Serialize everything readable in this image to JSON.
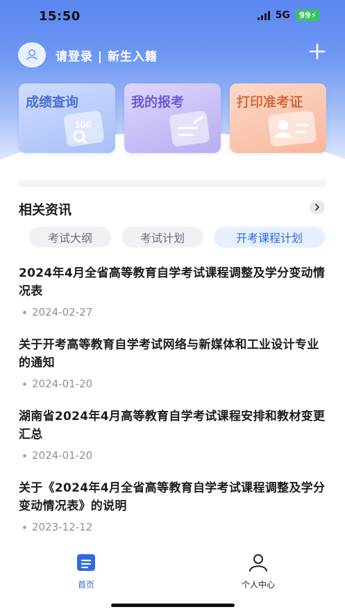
{
  "status_bar": {
    "time": "15:50",
    "network": "5G",
    "battery": "99"
  },
  "header": {
    "login_text": "请登录 | 新生入籍"
  },
  "cards": [
    {
      "label": "成绩查询"
    },
    {
      "label": "我的报考"
    },
    {
      "label": "打印准考证"
    }
  ],
  "card_deco_text": "100",
  "section": {
    "title": "相关资讯"
  },
  "tabs": [
    {
      "label": "考试大纲",
      "selected": false
    },
    {
      "label": "考试计划",
      "selected": false
    },
    {
      "label": "开考课程计划",
      "selected": true
    }
  ],
  "news": [
    {
      "title": "2024年4月全省高等教育自学考试课程调整及学分变动情况表",
      "date": "2024-02-27"
    },
    {
      "title": "关于开考高等教育自学考试网络与新媒体和工业设计专业的通知",
      "date": "2024-01-20"
    },
    {
      "title": "湖南省2024年4月高等教育自学考试课程安排和教材变更汇总",
      "date": "2024-01-20"
    },
    {
      "title": "关于《2024年4月全省高等教育自学考试课程调整及学分变动情况表》的说明",
      "date": "2023-12-12"
    }
  ],
  "tabbar": {
    "home_label": "首页",
    "me_label": "个人中心"
  },
  "colors": {
    "accent": "#2f6ae0",
    "hero_blue": "#5b86f0"
  }
}
